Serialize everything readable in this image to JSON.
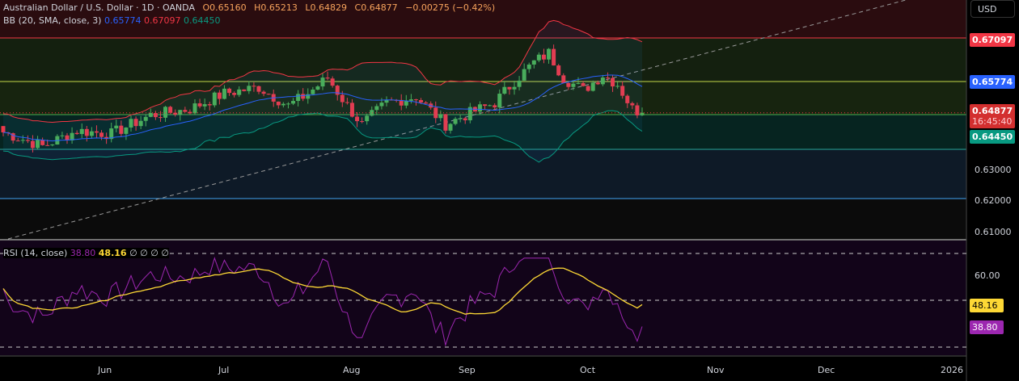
{
  "header": {
    "symbol": "Australian Dollar / U.S. Dollar · 1D · OANDA",
    "open": "O0.65160",
    "high": "H0.65213",
    "low": "L0.64829",
    "close": "C0.64877",
    "change": "−0.00275 (−0.42%)"
  },
  "bb": {
    "label": "BB (20, SMA, close, 3)",
    "basis": "0.65774",
    "upper": "0.67097",
    "lower": "0.64450"
  },
  "rsi": {
    "label": "RSI (14, close)",
    "value": "38.80",
    "ma": "48.16",
    "extras": [
      "∅",
      "∅",
      "∅",
      "∅"
    ]
  },
  "price_axis": {
    "currency": "USD",
    "ticks": [
      "0.63000",
      "0.62000",
      "0.61000"
    ],
    "upper_tag": "0.67097",
    "basis_tag": "0.65774",
    "last_tag": "0.64877",
    "countdown": "16:45:40",
    "lower_tag": "0.64450"
  },
  "rsi_axis": {
    "tick": "60.00",
    "ma_tag": "48.16",
    "rsi_tag": "38.80"
  },
  "time_axis": [
    "Jun",
    "Jul",
    "Aug",
    "Sep",
    "Oct",
    "Nov",
    "Dec",
    "2026"
  ],
  "colors": {
    "up": "#4caf50",
    "down": "#f23645",
    "basis": "#2962ff",
    "upper": "#f23645",
    "lower": "#089981",
    "rsi": "#9c27b0",
    "rsi_ma": "#fdd835"
  },
  "chart_data": {
    "type": "candlestick",
    "close_keypoints": [
      [
        0,
        0.6425
      ],
      [
        8,
        0.638
      ],
      [
        15,
        0.643
      ],
      [
        22,
        0.642
      ],
      [
        30,
        0.648
      ],
      [
        38,
        0.65
      ],
      [
        45,
        0.655
      ],
      [
        52,
        0.657
      ],
      [
        58,
        0.651
      ],
      [
        62,
        0.655
      ],
      [
        66,
        0.66
      ],
      [
        70,
        0.651
      ],
      [
        73,
        0.645
      ],
      [
        78,
        0.652
      ],
      [
        84,
        0.654
      ],
      [
        90,
        0.645
      ],
      [
        94,
        0.648
      ],
      [
        100,
        0.652
      ],
      [
        104,
        0.659
      ],
      [
        108,
        0.665
      ],
      [
        111,
        0.668
      ],
      [
        114,
        0.66
      ],
      [
        118,
        0.656
      ],
      [
        122,
        0.661
      ],
      [
        125,
        0.658
      ],
      [
        128,
        0.65
      ],
      [
        130,
        0.6488
      ]
    ]
  }
}
